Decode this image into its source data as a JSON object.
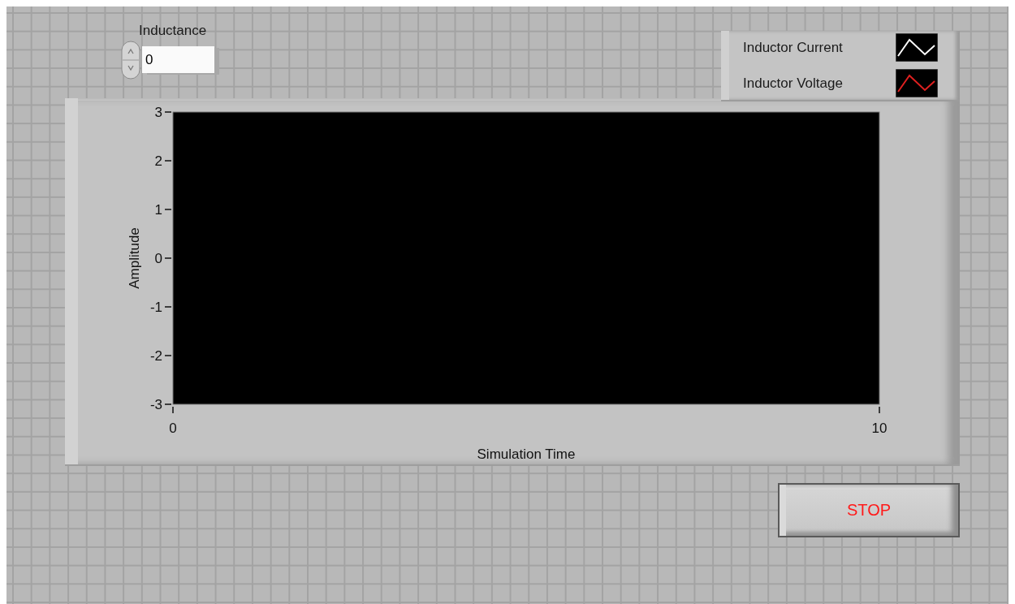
{
  "numeric": {
    "label": "Inductance",
    "value": "0"
  },
  "graph": {
    "y_axis_title": "Amplitude",
    "x_axis_title": "Simulation Time",
    "y_tick_labels": [
      "3",
      "2",
      "1",
      "0",
      "-1",
      "-2",
      "-3"
    ],
    "x_tick_labels": [
      "0",
      "10"
    ],
    "legend": [
      {
        "name": "Inductor Current",
        "color": "#ffffff"
      },
      {
        "name": "Inductor Voltage",
        "color": "#e02020"
      }
    ]
  },
  "stop_button": {
    "label": "STOP"
  }
}
